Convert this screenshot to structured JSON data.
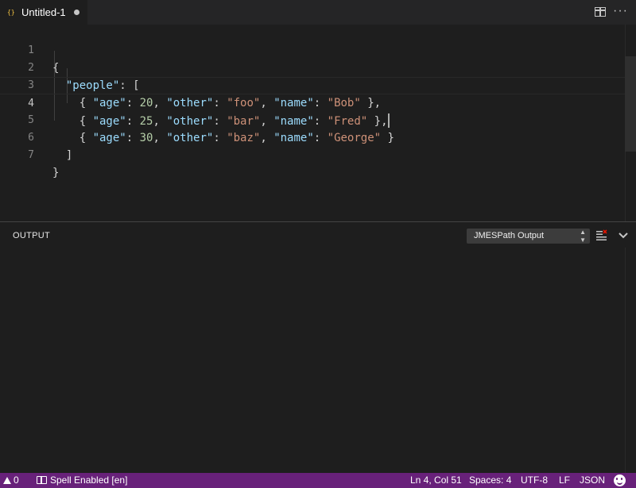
{
  "tab": {
    "icon": "{}",
    "title": "Untitled-1"
  },
  "editor": {
    "lines": [
      {
        "num": "1"
      },
      {
        "num": "2"
      },
      {
        "num": "3"
      },
      {
        "num": "4"
      },
      {
        "num": "5"
      },
      {
        "num": "6"
      },
      {
        "num": "7"
      }
    ],
    "tokens": {
      "open_brace": "{",
      "people_key": "\"people\"",
      "colon_bracket": ": [",
      "age_key": "\"age\"",
      "other_key": "\"other\"",
      "name_key": "\"name\"",
      "row_open": "{ ",
      "sep": ": ",
      "comma": ", ",
      "row_close": " },",
      "row_close_last": " }",
      "ages": [
        "20",
        "25",
        "30"
      ],
      "others": [
        "\"foo\"",
        "\"bar\"",
        "\"baz\""
      ],
      "names": [
        "\"Bob\"",
        "\"Fred\"",
        "\"George\""
      ],
      "close_bracket": "]",
      "close_brace": "}"
    }
  },
  "panel": {
    "title": "OUTPUT",
    "channel": "JMESPath Output"
  },
  "statusbar": {
    "warnings": "0",
    "spell": "Spell Enabled [en]",
    "cursor": "Ln 4, Col 51",
    "spaces": "Spaces: 4",
    "encoding": "UTF-8",
    "eol": "LF",
    "language": "JSON"
  },
  "colors": {
    "statusbar": "#68217a",
    "key": "#9cdcfe",
    "string": "#ce9178",
    "number": "#b5cea8"
  }
}
